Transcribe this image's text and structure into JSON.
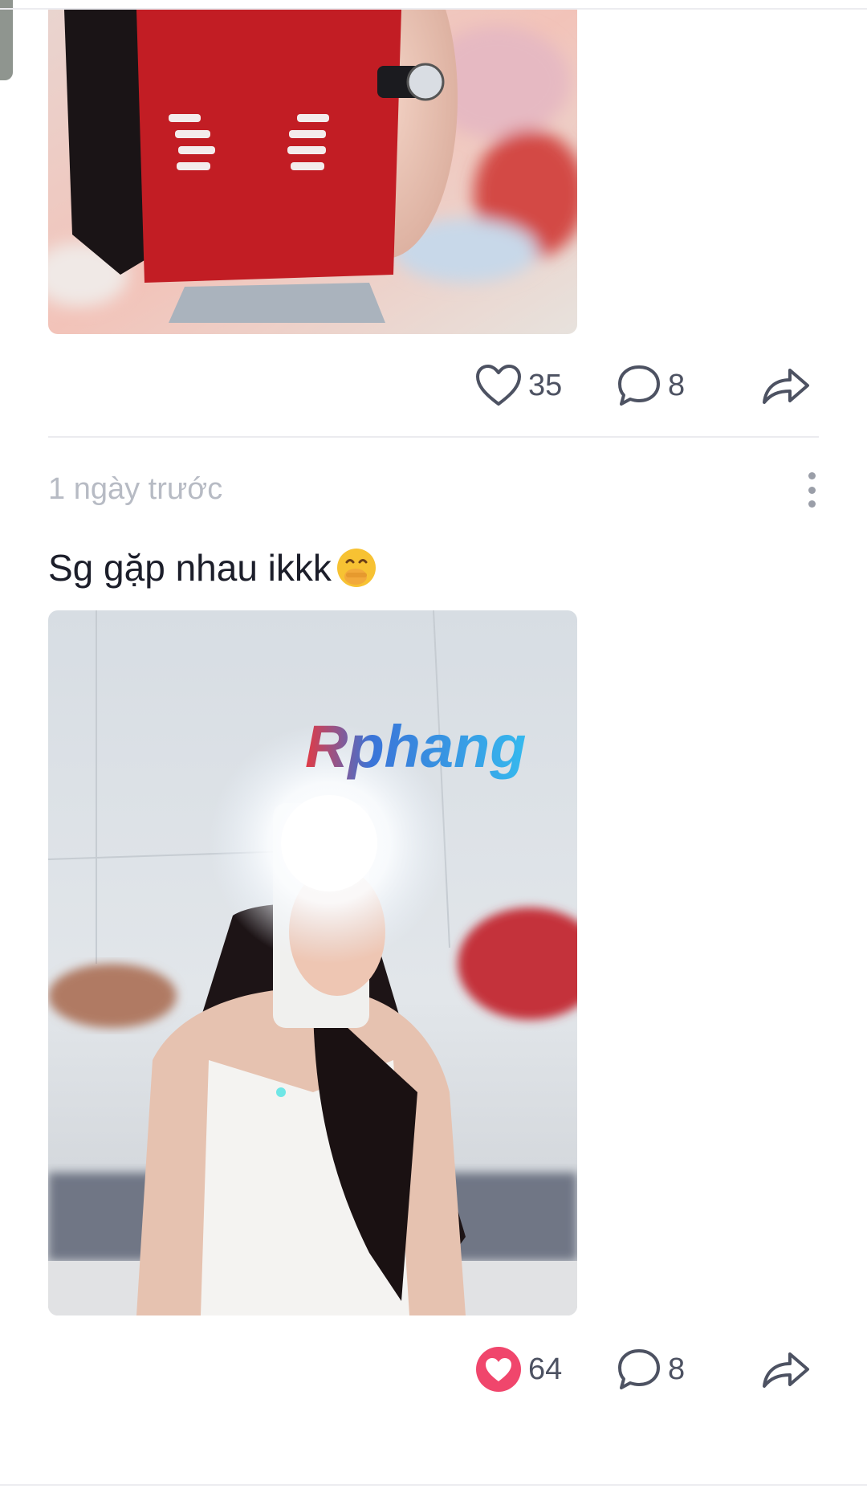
{
  "posts": [
    {
      "image_alt": "",
      "actions": {
        "likes": "35",
        "liked": false,
        "comments": "8"
      }
    },
    {
      "timestamp": "1 ngày trước",
      "caption": "Sg gặp nhau ikkk",
      "caption_emoji": "hand-over-mouth-emoji",
      "watermark": "Rphang",
      "actions": {
        "likes": "64",
        "liked": true,
        "comments": "8"
      }
    }
  ],
  "colors": {
    "liked_heart": "#f0466c",
    "icon_gray": "#4d5262",
    "timestamp_gray": "#b7bbc4"
  },
  "icons": {
    "like": "heart-icon",
    "comment": "comment-bubble-icon",
    "share": "share-arrow-icon",
    "more": "more-vertical-icon"
  }
}
